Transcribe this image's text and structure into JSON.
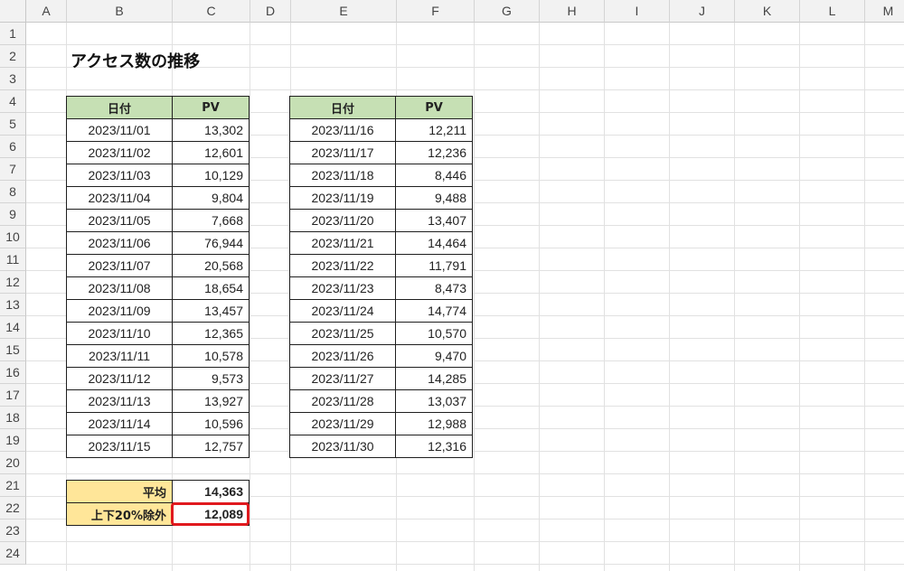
{
  "columns": [
    "A",
    "B",
    "C",
    "D",
    "E",
    "F",
    "G",
    "H",
    "I",
    "J",
    "K",
    "L",
    "M"
  ],
  "rows": [
    "1",
    "2",
    "3",
    "4",
    "5",
    "6",
    "7",
    "8",
    "9",
    "10",
    "11",
    "12",
    "13",
    "14",
    "15",
    "16",
    "17",
    "18",
    "19",
    "20",
    "21",
    "22",
    "23",
    "24"
  ],
  "title": "アクセス数の推移",
  "table_headers": {
    "date": "日付",
    "pv": "PV"
  },
  "left_table": [
    {
      "date": "2023/11/01",
      "pv": "13,302"
    },
    {
      "date": "2023/11/02",
      "pv": "12,601"
    },
    {
      "date": "2023/11/03",
      "pv": "10,129"
    },
    {
      "date": "2023/11/04",
      "pv": "9,804"
    },
    {
      "date": "2023/11/05",
      "pv": "7,668"
    },
    {
      "date": "2023/11/06",
      "pv": "76,944"
    },
    {
      "date": "2023/11/07",
      "pv": "20,568"
    },
    {
      "date": "2023/11/08",
      "pv": "18,654"
    },
    {
      "date": "2023/11/09",
      "pv": "13,457"
    },
    {
      "date": "2023/11/10",
      "pv": "12,365"
    },
    {
      "date": "2023/11/11",
      "pv": "10,578"
    },
    {
      "date": "2023/11/12",
      "pv": "9,573"
    },
    {
      "date": "2023/11/13",
      "pv": "13,927"
    },
    {
      "date": "2023/11/14",
      "pv": "10,596"
    },
    {
      "date": "2023/11/15",
      "pv": "12,757"
    }
  ],
  "right_table": [
    {
      "date": "2023/11/16",
      "pv": "12,211"
    },
    {
      "date": "2023/11/17",
      "pv": "12,236"
    },
    {
      "date": "2023/11/18",
      "pv": "8,446"
    },
    {
      "date": "2023/11/19",
      "pv": "9,488"
    },
    {
      "date": "2023/11/20",
      "pv": "13,407"
    },
    {
      "date": "2023/11/21",
      "pv": "14,464"
    },
    {
      "date": "2023/11/22",
      "pv": "11,791"
    },
    {
      "date": "2023/11/23",
      "pv": "8,473"
    },
    {
      "date": "2023/11/24",
      "pv": "14,774"
    },
    {
      "date": "2023/11/25",
      "pv": "10,570"
    },
    {
      "date": "2023/11/26",
      "pv": "9,470"
    },
    {
      "date": "2023/11/27",
      "pv": "14,285"
    },
    {
      "date": "2023/11/28",
      "pv": "13,037"
    },
    {
      "date": "2023/11/29",
      "pv": "12,988"
    },
    {
      "date": "2023/11/30",
      "pv": "12,316"
    }
  ],
  "summary": {
    "average_label": "平均",
    "average_value": "14,363",
    "trimmed_label": "上下20%除外",
    "trimmed_value": "12,089"
  },
  "colors": {
    "header_fill": "#c6e0b4",
    "summary_fill": "#ffe699",
    "highlight_border": "#e0191e"
  }
}
